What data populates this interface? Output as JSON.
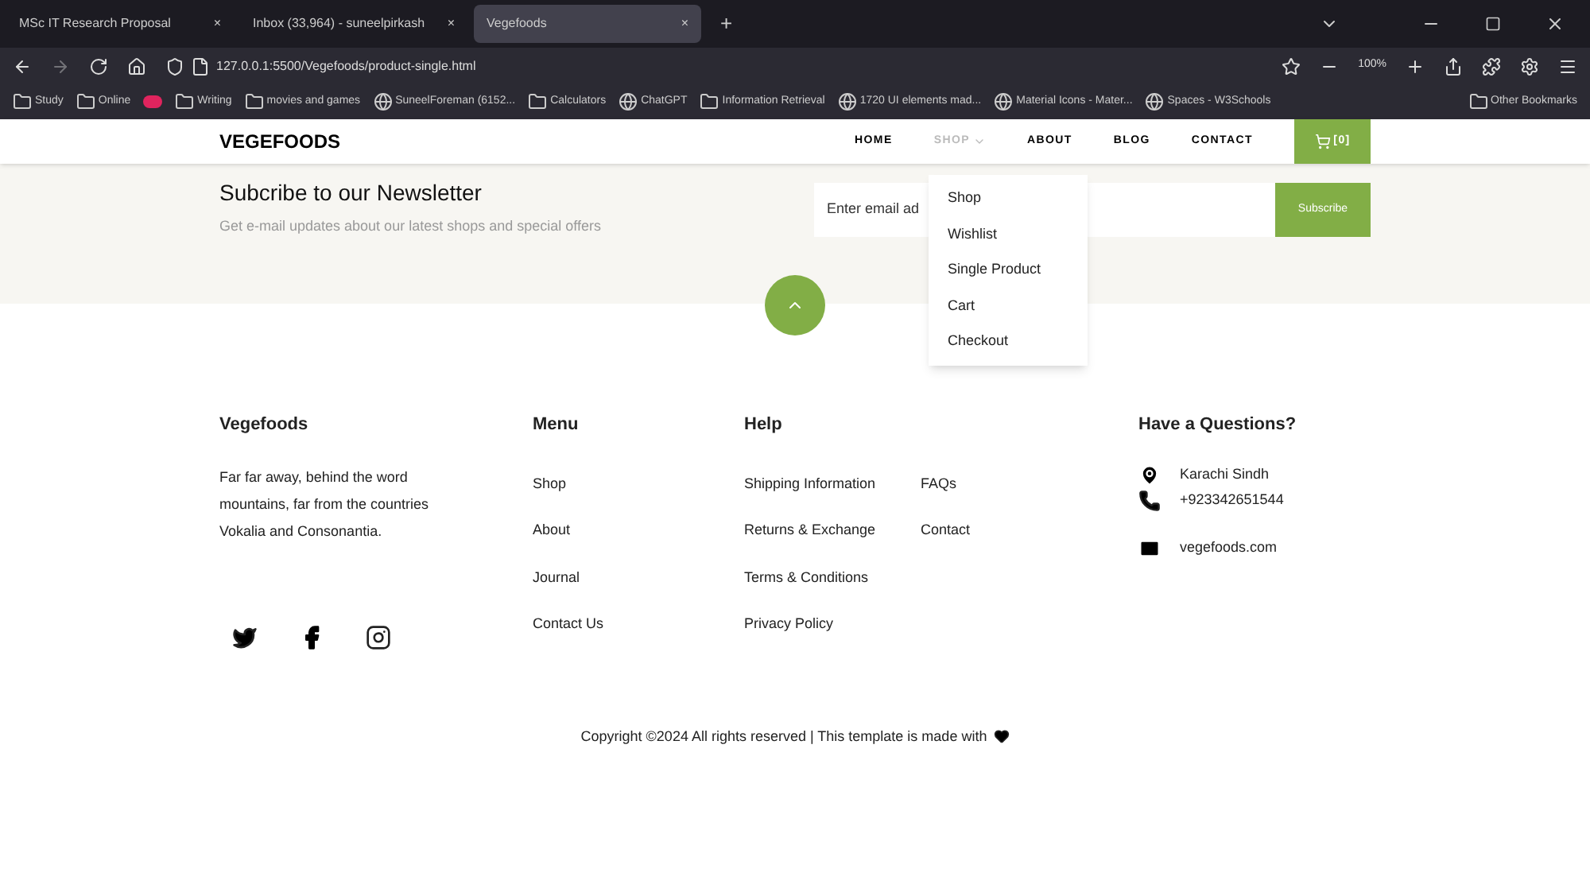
{
  "browser": {
    "tabs": [
      {
        "title": "MSc IT Research Proposal",
        "close": "×",
        "selected": false
      },
      {
        "title": "Inbox (33,964) - suneelpirkash",
        "close": "×",
        "selected": false
      },
      {
        "title": "Vegefoods",
        "close": "×",
        "selected": true
      }
    ],
    "new_tab": "+",
    "address": "127.0.0.1:5500/Vegefoods/product-single.html",
    "zoom": "100%",
    "bookmarks": [
      {
        "kind": "folder",
        "title": "Study"
      },
      {
        "kind": "folder",
        "title": "Online"
      },
      {
        "kind": "video"
      },
      {
        "kind": "folder",
        "title": "Writing"
      },
      {
        "kind": "folder",
        "title": "movies and games"
      },
      {
        "kind": "site",
        "title": "SuneelForeman (6152..."
      },
      {
        "kind": "folder",
        "title": "Calculators"
      },
      {
        "kind": "site",
        "title": "ChatGPT"
      },
      {
        "kind": "folder",
        "title": "Information Retrieval"
      },
      {
        "kind": "site",
        "title": "1720 UI elements mad..."
      },
      {
        "kind": "site",
        "title": "Material Icons - Mater..."
      },
      {
        "kind": "site",
        "title": "Spaces - W3Schools"
      }
    ],
    "other_bookmarks": "Other Bookmarks"
  },
  "header": {
    "logo": "VEGEFOODS",
    "nav": [
      {
        "label": "HOME",
        "selected": false
      },
      {
        "label": "SHOP",
        "selected": true
      },
      {
        "label": "ABOUT",
        "selected": false
      },
      {
        "label": "BLOG",
        "selected": false
      },
      {
        "label": "CONTACT",
        "selected": false
      }
    ],
    "cart": "[0]"
  },
  "dropdown": [
    "Shop",
    "Wishlist",
    "Single Product",
    "Cart",
    "Checkout"
  ],
  "newsletter": {
    "title": "Subcribe to our Newsletter",
    "subtitle": "Get e-mail updates about our latest shops and special offers",
    "placeholder": "Enter email ad",
    "button": "Subscribe"
  },
  "footer": {
    "about": {
      "title": "Vegefoods",
      "text": "Far far away, behind the word mountains, far from the countries Vokalia and Consonantia."
    },
    "menu": {
      "title": "Menu",
      "links": [
        "Shop",
        "About",
        "Journal",
        "Contact Us"
      ]
    },
    "help": {
      "title": "Help",
      "links": [
        "Shipping Information",
        "Returns & Exchange",
        "Terms & Conditions",
        "Privacy Policy"
      ],
      "links_2": [
        "FAQs",
        "Contact"
      ]
    },
    "contact": {
      "title": "Have a Questions?",
      "items": [
        {
          "kind": "location",
          "text": "Karachi Sindh"
        },
        {
          "kind": "phone",
          "text": "+923342651544"
        },
        {
          "kind": "email",
          "text": "vegefoods.com"
        }
      ]
    },
    "copyright": "Copyright ©2024 All rights reserved | This template is made with"
  }
}
